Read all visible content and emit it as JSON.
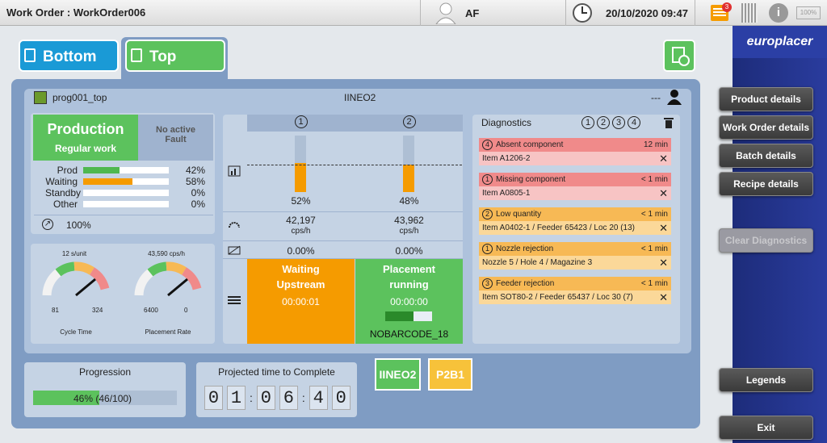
{
  "header": {
    "work_order": "Work Order : WorkOrder006",
    "user": "AF",
    "datetime": "20/10/2020 09:47",
    "notif_count": "3",
    "battery": "100%"
  },
  "brand": "europlacer",
  "tabs": {
    "bottom": "Bottom",
    "top": "Top"
  },
  "panel": {
    "program": "prog001_top",
    "machine": "IINEO2",
    "dashes": "---"
  },
  "production": {
    "title": "Production",
    "subtitle": "Regular work",
    "fault": "No active Fault",
    "rows": [
      {
        "label": "Prod",
        "value": "42%",
        "fill": 0.42,
        "color": "#4fb84f"
      },
      {
        "label": "Waiting",
        "value": "58%",
        "fill": 0.58,
        "color": "#f59b00"
      },
      {
        "label": "Standby",
        "value": "0%",
        "fill": 0,
        "color": "#4fb84f"
      },
      {
        "label": "Other",
        "value": "0%",
        "fill": 0,
        "color": "#4fb84f"
      }
    ],
    "efficiency": "100%"
  },
  "gauges": {
    "cycle": {
      "top": "12 s/unit",
      "min": "81",
      "max": "324",
      "label": "Cycle Time"
    },
    "rate": {
      "top": "43,590 cps/h",
      "min": "6400",
      "max": "0",
      "label": "Placement Rate"
    }
  },
  "heads": [
    {
      "num": "1",
      "pct": "52%",
      "pct_val": 0.52,
      "cps": "42,197",
      "unit": "cps/h",
      "rej": "0.00%",
      "status1": "Waiting",
      "status2": "Upstream",
      "time": "00:00:01",
      "color": "#f59b00",
      "barcode": ""
    },
    {
      "num": "2",
      "pct": "48%",
      "pct_val": 0.48,
      "cps": "43,962",
      "unit": "cps/h",
      "rej": "0.00%",
      "status1": "Placement",
      "status2": "running",
      "time": "00:00:00",
      "color": "#5cc25d",
      "barcode": "NOBARCODE_18"
    }
  ],
  "diagnostics": {
    "title": "Diagnostics",
    "items": [
      {
        "n": "4",
        "title": "Absent component",
        "time": "12 min",
        "detail": "Item A1206-2",
        "kind": "red"
      },
      {
        "n": "1",
        "title": "Missing component",
        "time": "< 1 min",
        "detail": "Item A0805-1",
        "kind": "red"
      },
      {
        "n": "2",
        "title": "Low quantity",
        "time": "< 1 min",
        "detail": "Item A0402-1 / Feeder 65423 / Loc 20 (13)",
        "kind": "org"
      },
      {
        "n": "1",
        "title": "Nozzle rejection",
        "time": "< 1 min",
        "detail": "Nozzle 5 / Hole 4 / Magazine 3",
        "kind": "org"
      },
      {
        "n": "3",
        "title": "Feeder rejection",
        "time": "< 1 min",
        "detail": "Item SOT80-2 / Feeder 65437 / Loc 30 (7)",
        "kind": "org"
      }
    ]
  },
  "progression": {
    "title": "Progression",
    "text": "46% (46/100)",
    "fill": 0.46
  },
  "projected": {
    "title": "Projected time to Complete",
    "digits": [
      "0",
      "1",
      "0",
      "6",
      "4",
      "0"
    ]
  },
  "lines": {
    "a": "IINEO2",
    "b": "P2B1"
  },
  "sidebar": {
    "product": "Product details",
    "work_order": "Work Order details",
    "batch": "Batch details",
    "recipe": "Recipe details",
    "clear": "Clear Diagnostics",
    "legends": "Legends",
    "exit": "Exit"
  }
}
